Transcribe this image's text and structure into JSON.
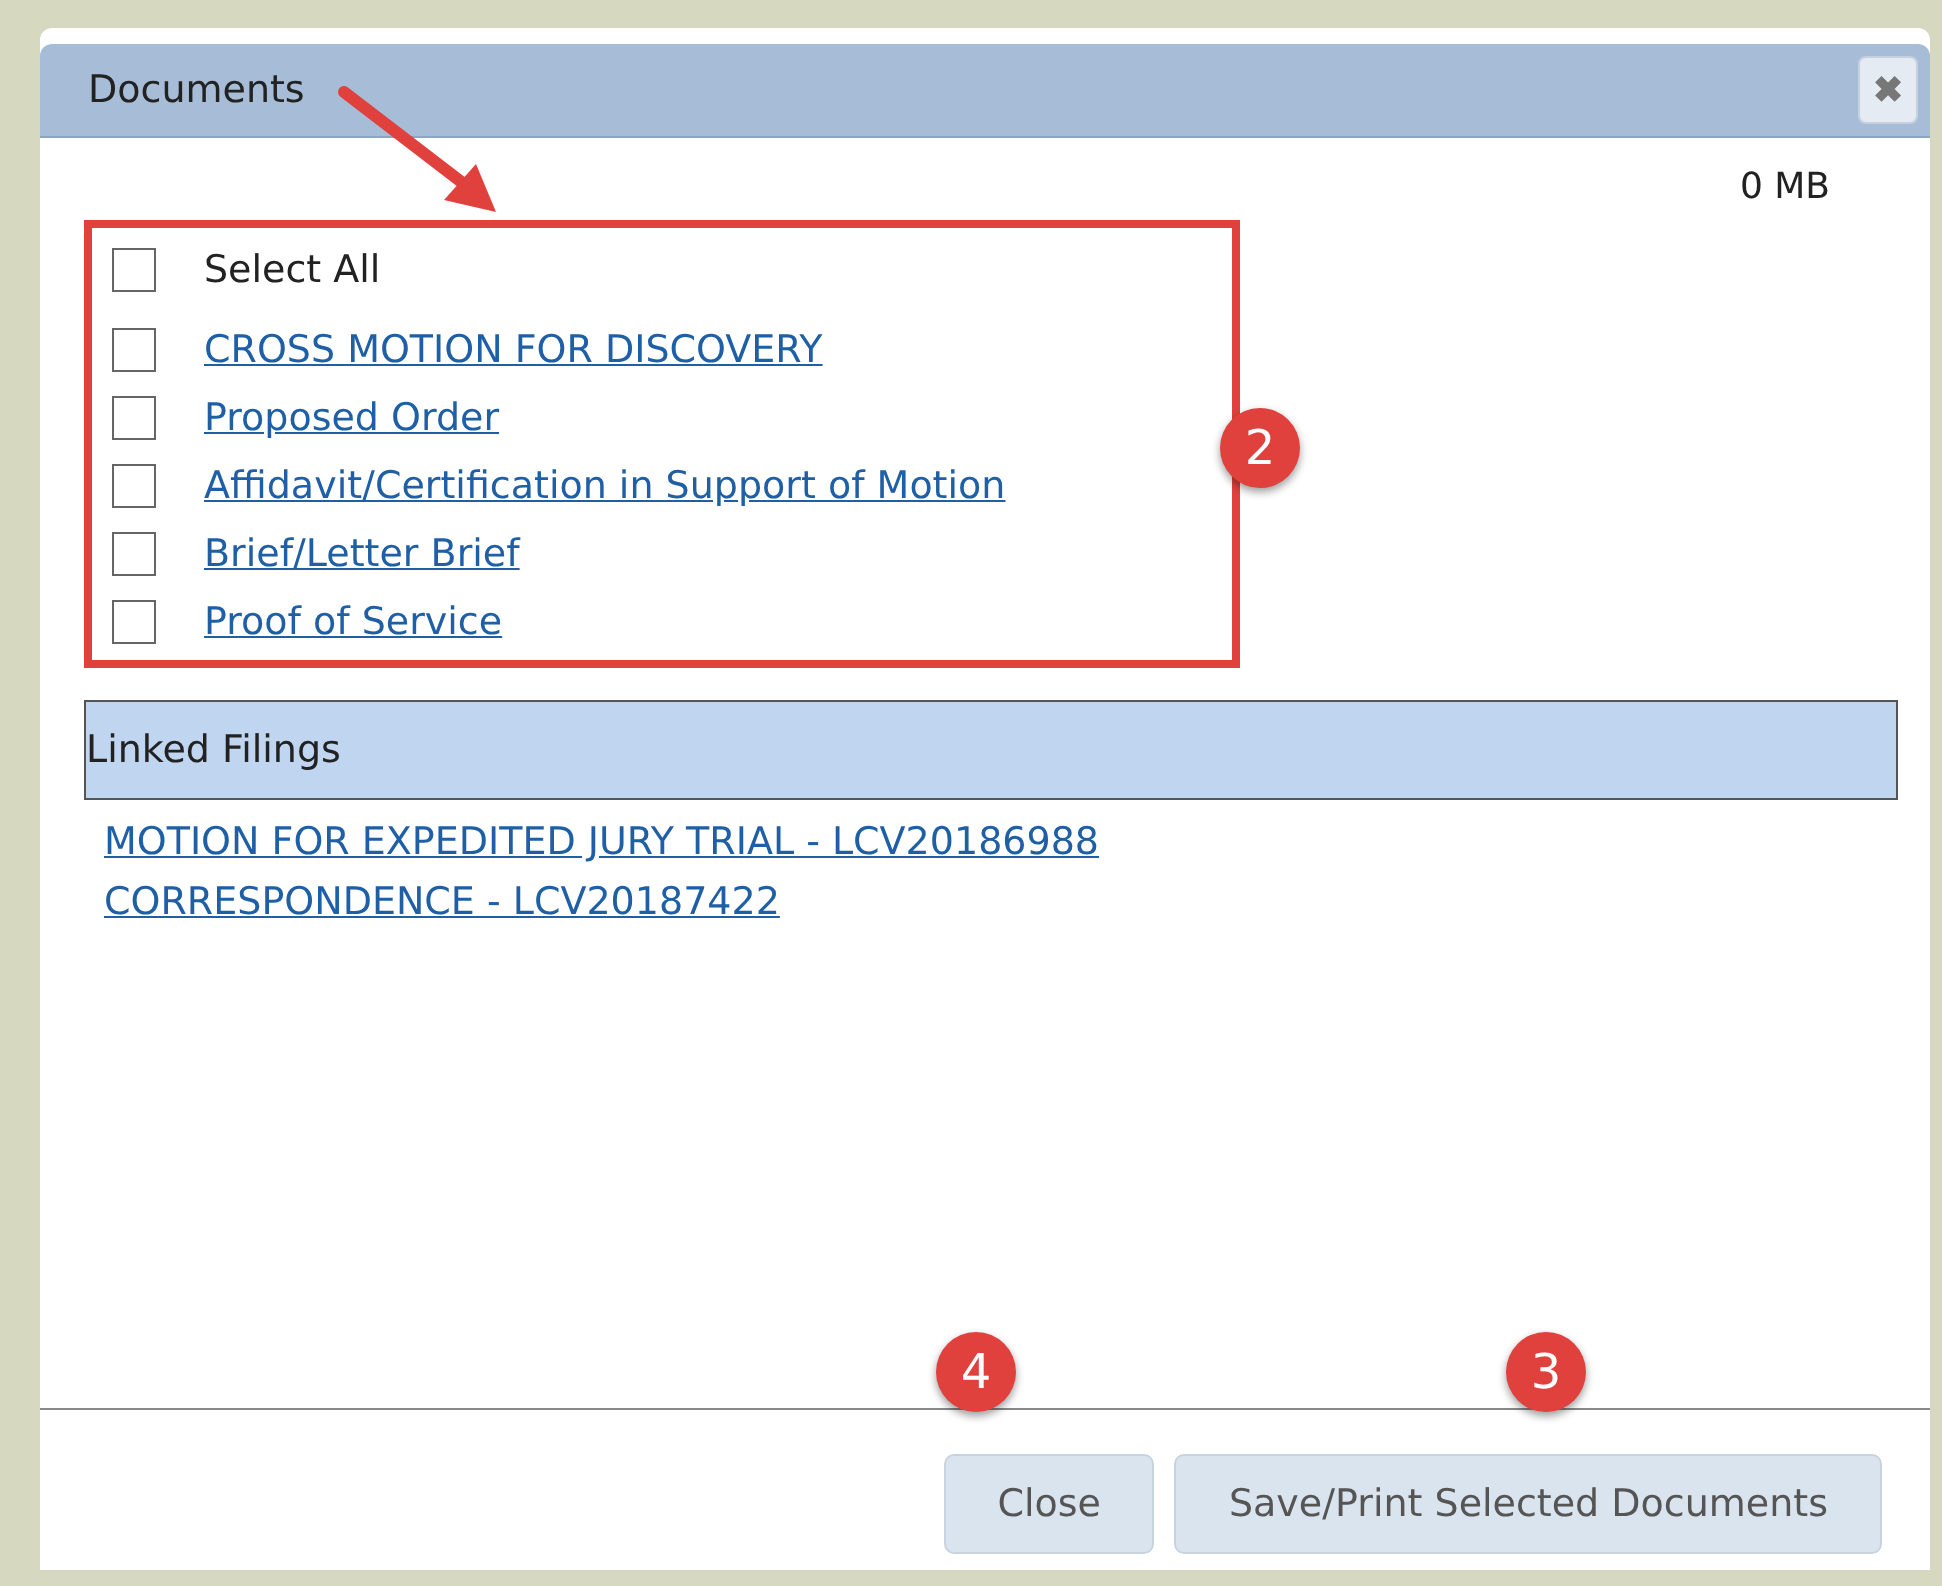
{
  "dialog": {
    "title": "Documents",
    "close_icon": "✖"
  },
  "size": "0 MB",
  "documents": [
    {
      "label": "Select All",
      "kind": "plain",
      "checked": false
    },
    {
      "label": "CROSS MOTION FOR DISCOVERY",
      "kind": "link",
      "checked": false
    },
    {
      "label": "Proposed Order",
      "kind": "link",
      "checked": false
    },
    {
      "label": "Affidavit/Certification in Support of Motion",
      "kind": "link",
      "checked": false
    },
    {
      "label": "Brief/Letter Brief",
      "kind": "link",
      "checked": false
    },
    {
      "label": "Proof of Service",
      "kind": "link",
      "checked": false
    }
  ],
  "linked_filings": {
    "header": "Linked Filings",
    "links": [
      "MOTION FOR EXPEDITED JURY TRIAL - LCV20186988",
      "CORRESPONDENCE - LCV20187422"
    ]
  },
  "buttons": [
    "Close",
    "Save/Print Selected Documents"
  ],
  "callouts": [
    "2",
    "4",
    "3"
  ]
}
